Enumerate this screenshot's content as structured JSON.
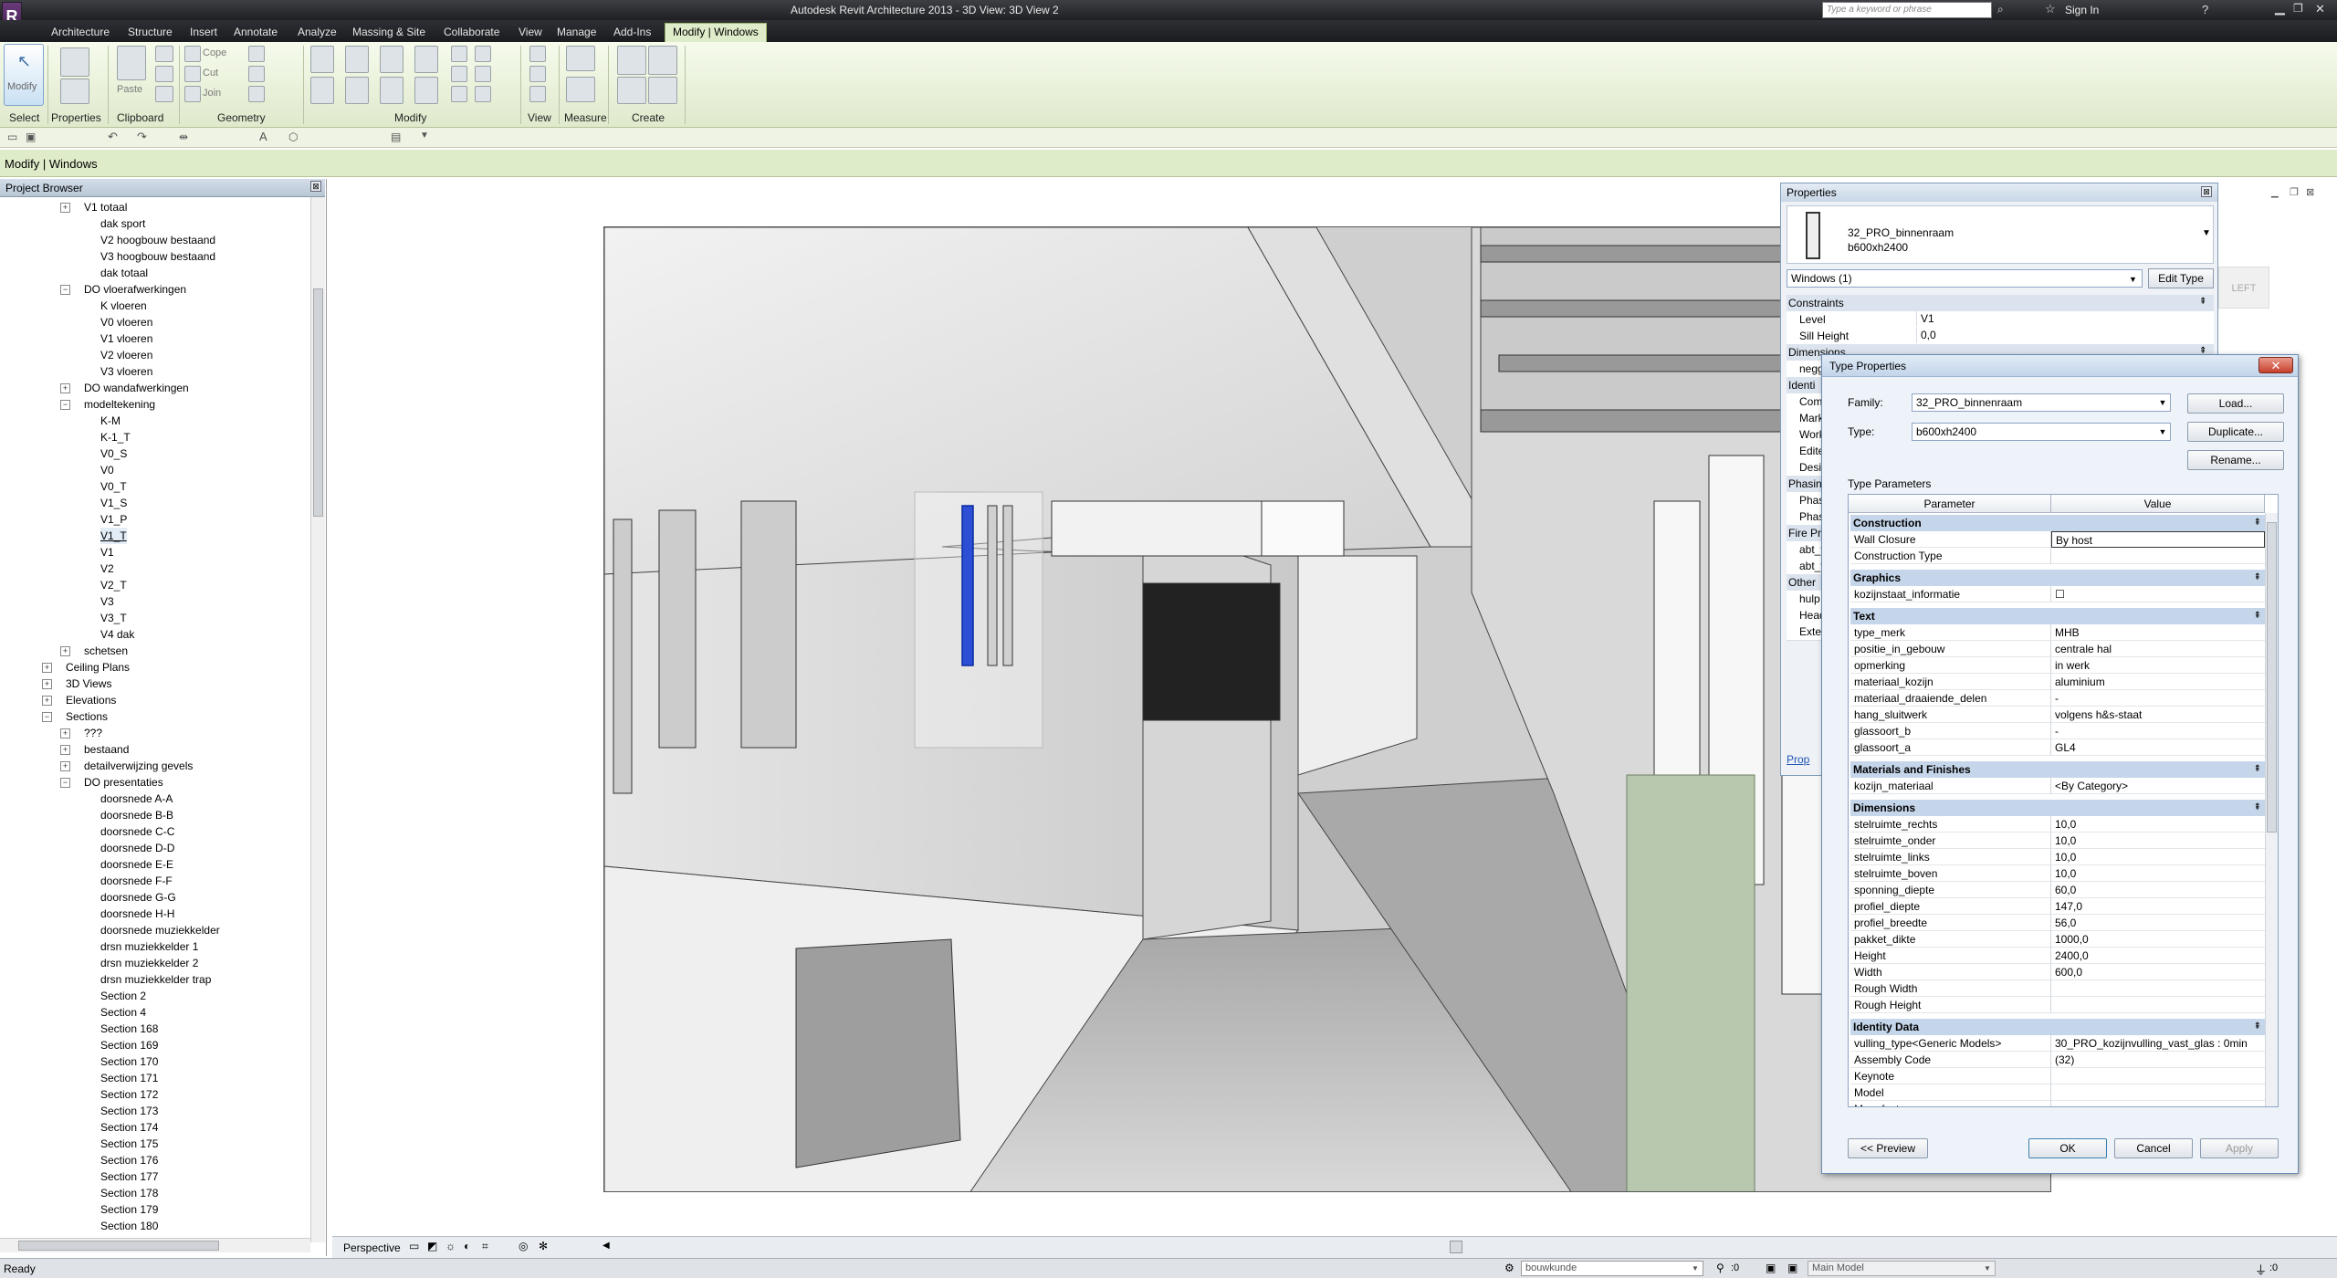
{
  "app": {
    "title": "Autodesk Revit Architecture 2013 -   3D View: 3D View 2",
    "search_placeholder": "Type a keyword or phrase",
    "sign_in": "Sign In"
  },
  "menu_tabs": [
    "Architecture",
    "Structure",
    "Insert",
    "Annotate",
    "Analyze",
    "Massing & Site",
    "Collaborate",
    "View",
    "Manage",
    "Add-Ins",
    "Modify | Windows"
  ],
  "ribbon": {
    "panels": [
      "Select",
      "Properties",
      "Clipboard",
      "Geometry",
      "Modify",
      "View",
      "Measure",
      "Create"
    ],
    "big_buttons": {
      "modify": "Modify",
      "paste": "Paste"
    },
    "small_buttons": {
      "cope": "Cope",
      "cut": "Cut",
      "join": "Join"
    }
  },
  "options_bar": {
    "context": "Modify | Windows"
  },
  "project_browser": {
    "title": "Project Browser",
    "rows": [
      {
        "label": "V1 totaal",
        "level": 3,
        "box": "plus"
      },
      {
        "label": "dak sport",
        "level": 4,
        "box": ""
      },
      {
        "label": "V2 hoogbouw bestaand",
        "level": 4,
        "box": ""
      },
      {
        "label": "V3 hoogbouw bestaand",
        "level": 4,
        "box": ""
      },
      {
        "label": "dak totaal",
        "level": 4,
        "box": ""
      },
      {
        "label": "DO vloerafwerkingen",
        "level": 3,
        "box": "minus"
      },
      {
        "label": "K vloeren",
        "level": 4,
        "box": ""
      },
      {
        "label": "V0 vloeren",
        "level": 4,
        "box": ""
      },
      {
        "label": "V1 vloeren",
        "level": 4,
        "box": ""
      },
      {
        "label": "V2 vloeren",
        "level": 4,
        "box": ""
      },
      {
        "label": "V3 vloeren",
        "level": 4,
        "box": ""
      },
      {
        "label": "DO wandafwerkingen",
        "level": 3,
        "box": "plus"
      },
      {
        "label": "modeltekening",
        "level": 3,
        "box": "minus"
      },
      {
        "label": "K-M",
        "level": 4,
        "box": ""
      },
      {
        "label": "K-1_T",
        "level": 4,
        "box": ""
      },
      {
        "label": "V0_S",
        "level": 4,
        "box": ""
      },
      {
        "label": "V0",
        "level": 4,
        "box": ""
      },
      {
        "label": "V0_T",
        "level": 4,
        "box": ""
      },
      {
        "label": "V1_S",
        "level": 4,
        "box": ""
      },
      {
        "label": "V1_P",
        "level": 4,
        "box": ""
      },
      {
        "label": "V1_T",
        "level": 4,
        "box": "",
        "selected": true
      },
      {
        "label": "V1",
        "level": 4,
        "box": ""
      },
      {
        "label": "V2",
        "level": 4,
        "box": ""
      },
      {
        "label": "V2_T",
        "level": 4,
        "box": ""
      },
      {
        "label": "V3",
        "level": 4,
        "box": ""
      },
      {
        "label": "V3_T",
        "level": 4,
        "box": ""
      },
      {
        "label": "V4 dak",
        "level": 4,
        "box": ""
      },
      {
        "label": "schetsen",
        "level": 3,
        "box": "plus"
      },
      {
        "label": "Ceiling Plans",
        "level": 2,
        "box": "plus"
      },
      {
        "label": "3D Views",
        "level": 2,
        "box": "plus"
      },
      {
        "label": "Elevations",
        "level": 2,
        "box": "plus"
      },
      {
        "label": "Sections",
        "level": 2,
        "box": "minus"
      },
      {
        "label": "???",
        "level": 3,
        "box": "plus"
      },
      {
        "label": "bestaand",
        "level": 3,
        "box": "plus"
      },
      {
        "label": "detailverwijzing gevels",
        "level": 3,
        "box": "plus"
      },
      {
        "label": "DO presentaties",
        "level": 3,
        "box": "minus"
      },
      {
        "label": "doorsnede A-A",
        "level": 4,
        "box": ""
      },
      {
        "label": "doorsnede B-B",
        "level": 4,
        "box": ""
      },
      {
        "label": "doorsnede C-C",
        "level": 4,
        "box": ""
      },
      {
        "label": "doorsnede D-D",
        "level": 4,
        "box": ""
      },
      {
        "label": "doorsnede E-E",
        "level": 4,
        "box": ""
      },
      {
        "label": "doorsnede F-F",
        "level": 4,
        "box": ""
      },
      {
        "label": "doorsnede G-G",
        "level": 4,
        "box": ""
      },
      {
        "label": "doorsnede H-H",
        "level": 4,
        "box": ""
      },
      {
        "label": "doorsnede muziekkelder",
        "level": 4,
        "box": ""
      },
      {
        "label": "drsn muziekkelder 1",
        "level": 4,
        "box": ""
      },
      {
        "label": "drsn muziekkelder 2",
        "level": 4,
        "box": ""
      },
      {
        "label": "drsn muziekkelder trap",
        "level": 4,
        "box": ""
      },
      {
        "label": "Section 2",
        "level": 4,
        "box": ""
      },
      {
        "label": "Section 4",
        "level": 4,
        "box": ""
      },
      {
        "label": "Section 168",
        "level": 4,
        "box": ""
      },
      {
        "label": "Section 169",
        "level": 4,
        "box": ""
      },
      {
        "label": "Section 170",
        "level": 4,
        "box": ""
      },
      {
        "label": "Section 171",
        "level": 4,
        "box": ""
      },
      {
        "label": "Section 172",
        "level": 4,
        "box": ""
      },
      {
        "label": "Section 173",
        "level": 4,
        "box": ""
      },
      {
        "label": "Section 174",
        "level": 4,
        "box": ""
      },
      {
        "label": "Section 175",
        "level": 4,
        "box": ""
      },
      {
        "label": "Section 176",
        "level": 4,
        "box": ""
      },
      {
        "label": "Section 177",
        "level": 4,
        "box": ""
      },
      {
        "label": "Section 178",
        "level": 4,
        "box": ""
      },
      {
        "label": "Section 179",
        "level": 4,
        "box": ""
      },
      {
        "label": "Section 180",
        "level": 4,
        "box": ""
      }
    ]
  },
  "properties": {
    "title": "Properties",
    "family_name": "32_PRO_binnenraam",
    "type_name": "b600xh2400",
    "selector": "Windows (1)",
    "edit_type": "Edit Type",
    "rows": [
      {
        "kind": "cat",
        "label": "Constraints"
      },
      {
        "kind": "row",
        "label": "Level",
        "value": "V1"
      },
      {
        "kind": "row",
        "label": "Sill Height",
        "value": "0,0"
      },
      {
        "kind": "cat",
        "label": "Dimensions"
      },
      {
        "kind": "row",
        "label": "negg",
        "value": ""
      },
      {
        "kind": "cat",
        "label": "Identi"
      },
      {
        "kind": "row",
        "label": "Com",
        "value": ""
      },
      {
        "kind": "row",
        "label": "Mark",
        "value": ""
      },
      {
        "kind": "row",
        "label": "Work",
        "value": ""
      },
      {
        "kind": "row",
        "label": "Edite",
        "value": ""
      },
      {
        "kind": "row",
        "label": "Desig",
        "value": ""
      },
      {
        "kind": "cat",
        "label": "Phasin"
      },
      {
        "kind": "row",
        "label": "Phas",
        "value": ""
      },
      {
        "kind": "row",
        "label": "Phas",
        "value": ""
      },
      {
        "kind": "cat",
        "label": "Fire Pr"
      },
      {
        "kind": "row",
        "label": "abt_v",
        "value": ""
      },
      {
        "kind": "row",
        "label": "abt_v",
        "value": ""
      },
      {
        "kind": "cat",
        "label": "Other"
      },
      {
        "kind": "row",
        "label": "hulp",
        "value": ""
      },
      {
        "kind": "row",
        "label": "Head",
        "value": ""
      },
      {
        "kind": "row",
        "label": "Exter",
        "value": ""
      }
    ],
    "help_link": "Prop"
  },
  "view_cube_label": "LEFT",
  "type_properties": {
    "title": "Type Properties",
    "family_label": "Family:",
    "family_value": "32_PRO_binnenraam",
    "type_label": "Type:",
    "type_value": "b600xh2400",
    "load": "Load...",
    "duplicate": "Duplicate...",
    "rename": "Rename...",
    "params_heading": "Type Parameters",
    "col_parameter": "Parameter",
    "col_value": "Value",
    "groups": [
      {
        "name": "Construction",
        "rows": [
          [
            "Wall Closure",
            "By host"
          ],
          [
            "Construction Type",
            ""
          ]
        ]
      },
      {
        "name": "Graphics",
        "rows": [
          [
            "kozijnstaat_informatie",
            "☐"
          ]
        ]
      },
      {
        "name": "Text",
        "rows": [
          [
            "type_merk",
            "MHB"
          ],
          [
            "positie_in_gebouw",
            "centrale hal"
          ],
          [
            "opmerking",
            "in werk"
          ],
          [
            "materiaal_kozijn",
            "aluminium"
          ],
          [
            "materiaal_draaiende_delen",
            "-"
          ],
          [
            "hang_sluitwerk",
            "volgens h&s-staat"
          ],
          [
            "glassoort_b",
            "-"
          ],
          [
            "glassoort_a",
            "GL4"
          ]
        ]
      },
      {
        "name": "Materials and Finishes",
        "rows": [
          [
            "kozijn_materiaal",
            "<By Category>"
          ]
        ]
      },
      {
        "name": "Dimensions",
        "rows": [
          [
            "stelruimte_rechts",
            "10,0"
          ],
          [
            "stelruimte_onder",
            "10,0"
          ],
          [
            "stelruimte_links",
            "10,0"
          ],
          [
            "stelruimte_boven",
            "10,0"
          ],
          [
            "sponning_diepte",
            "60,0"
          ],
          [
            "profiel_diepte",
            "147,0"
          ],
          [
            "profiel_breedte",
            "56,0"
          ],
          [
            "pakket_dikte",
            "1000,0"
          ],
          [
            "Height",
            "2400,0"
          ],
          [
            "Width",
            "600,0"
          ],
          [
            "Rough Width",
            ""
          ],
          [
            "Rough Height",
            ""
          ]
        ]
      },
      {
        "name": "Identity Data",
        "rows": [
          [
            "vulling_type<Generic Models>",
            "30_PRO_kozijnvulling_vast_glas : 0min"
          ],
          [
            "Assembly Code",
            "(32)"
          ],
          [
            "Keynote",
            ""
          ],
          [
            "Model",
            ""
          ],
          [
            "Manufacturer",
            ""
          ]
        ]
      }
    ],
    "preview": "<< Preview",
    "ok": "OK",
    "cancel": "Cancel",
    "apply": "Apply"
  },
  "view_control": {
    "mode": "Perspective"
  },
  "status": {
    "text": "Ready",
    "workset": "bouwkunde",
    "zero": ":0",
    "model": "Main Model"
  }
}
